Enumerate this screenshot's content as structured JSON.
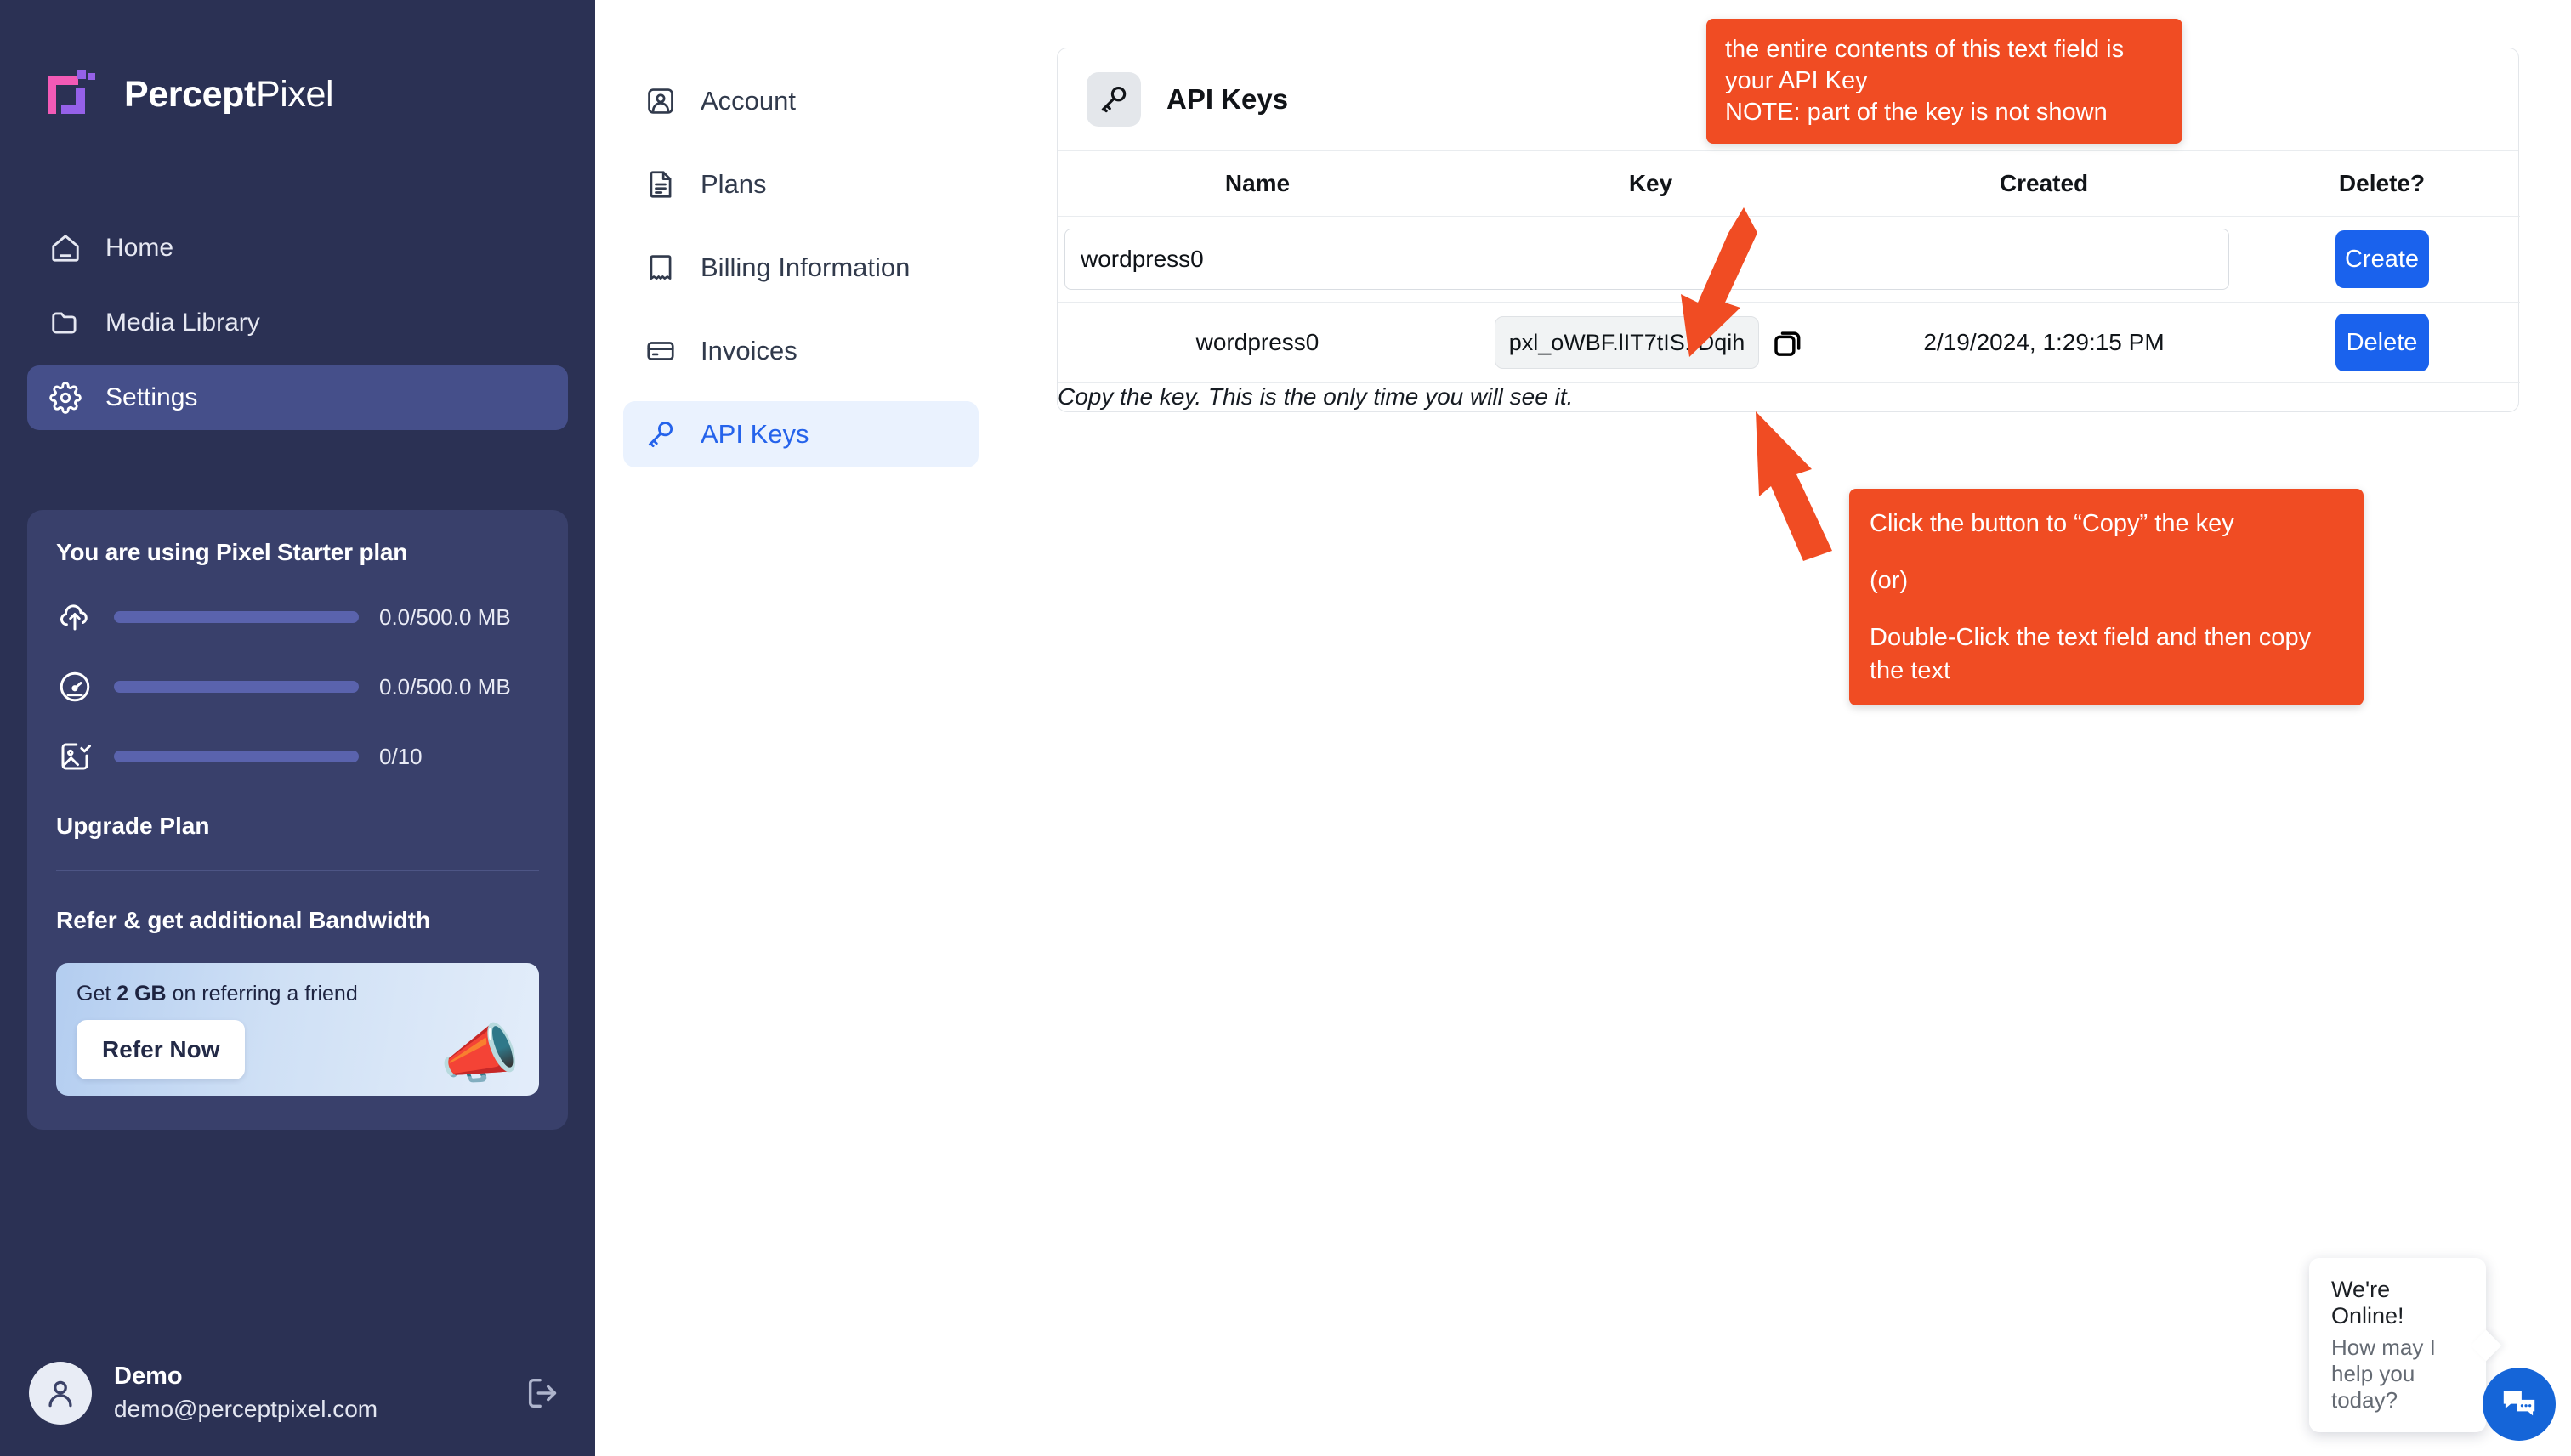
{
  "brand": {
    "name_bold": "Percept",
    "name_light": "Pixel",
    "colors": {
      "pink": "#f25ab6",
      "purple": "#9561e8",
      "sidebar_bg": "#2b3154",
      "accent_blue": "#1a62ed",
      "annotation_orange": "#f04c23"
    }
  },
  "sidebar": {
    "items": [
      {
        "label": "Home",
        "icon": "home-icon",
        "active": false
      },
      {
        "label": "Media Library",
        "icon": "folder-icon",
        "active": false
      },
      {
        "label": "Settings",
        "icon": "gear-icon",
        "active": true
      }
    ],
    "plan": {
      "title": "You are using Pixel Starter plan",
      "meters": [
        {
          "icon": "cloud-upload-icon",
          "value": "0.0/500.0 MB"
        },
        {
          "icon": "gauge-icon",
          "value": "0.0/500.0 MB"
        },
        {
          "icon": "image-check-icon",
          "value": "0/10"
        }
      ],
      "upgrade_label": "Upgrade Plan"
    },
    "refer": {
      "title": "Refer & get additional Bandwidth",
      "offer_prefix": "Get ",
      "offer_amount": "2 GB",
      "offer_suffix": " on referring a friend",
      "button_label": "Refer Now",
      "icon": "megaphone-icon"
    },
    "user": {
      "name": "Demo",
      "email": "demo@perceptpixel.com",
      "avatar_icon": "user-icon",
      "logout_icon": "logout-icon"
    }
  },
  "settings_nav": {
    "items": [
      {
        "label": "Account",
        "icon": "account-card-icon",
        "active": false
      },
      {
        "label": "Plans",
        "icon": "document-icon",
        "active": false
      },
      {
        "label": "Billing Information",
        "icon": "receipt-icon",
        "active": false
      },
      {
        "label": "Invoices",
        "icon": "credit-card-icon",
        "active": false
      },
      {
        "label": "API Keys",
        "icon": "key-icon",
        "active": true
      }
    ]
  },
  "main": {
    "card_title": "API Keys",
    "card_icon": "key-icon",
    "table": {
      "headers": [
        "Name",
        "Key",
        "Created",
        "Delete?"
      ],
      "new_key": {
        "name_value": "wordpress0",
        "name_placeholder": "",
        "create_label": "Create"
      },
      "rows": [
        {
          "name": "wordpress0",
          "key": "pxl_oWBF.lIT7tIS1Dqih",
          "created": "2/19/2024, 1:29:15 PM",
          "delete_label": "Delete",
          "copy_icon": "copy-icon"
        }
      ],
      "hint": "Copy the key. This is the only time you will see it."
    }
  },
  "annotations": {
    "tip_1": "the entire contents of this text field is your API Key\nNOTE: part of the key is not shown",
    "tip_2_line1": "Click the button to “Copy” the key",
    "tip_2_line2": "(or)",
    "tip_2_line3": "Double-Click the text field and then copy the text"
  },
  "chat": {
    "title": "We're Online!",
    "subtitle": "How may I help you today?",
    "fab_icon": "chat-bubbles-icon"
  }
}
